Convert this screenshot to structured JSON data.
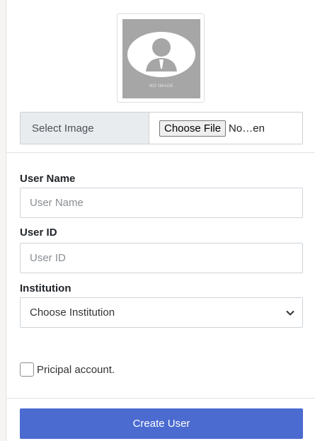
{
  "avatar": {
    "caption": "NO IMAGE",
    "icon": "user-silhouette-icon"
  },
  "file_picker": {
    "label": "Select Image",
    "button_label": "Choose File",
    "status_text": "No…en"
  },
  "form": {
    "user_name": {
      "label": "User Name",
      "placeholder": "User Name"
    },
    "user_id": {
      "label": "User ID",
      "placeholder": "User ID"
    },
    "institution": {
      "label": "Institution",
      "selected": "Choose Institution",
      "icon": "chevron-down-icon"
    },
    "principal_checkbox": {
      "label": "Pricipal account.",
      "checked": false
    },
    "submit_label": "Create User"
  },
  "colors": {
    "primary": "#4b6bd1",
    "label_bg": "#e9ecef",
    "avatar_bg": "#a6a6a6",
    "border": "#ced4da"
  }
}
